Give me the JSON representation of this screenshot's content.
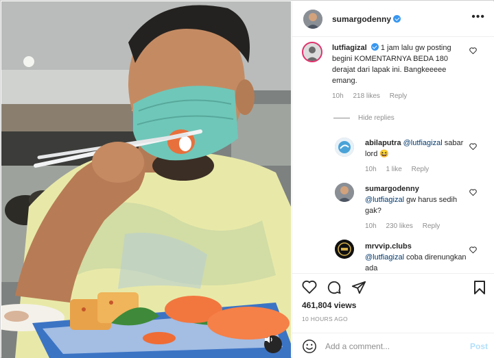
{
  "post": {
    "author": "sumargodenny",
    "more_icon": "more-horizontal-icon"
  },
  "comments": {
    "main": {
      "user": "lutfiagizal",
      "text": "1 jam lalu gw posting begini KOMENTARNYA BEDA 180 derajat dari lapak ini. Bangkeeeee emang.",
      "time": "10h",
      "likes": "218 likes",
      "reply": "Reply"
    },
    "hide_replies": "Hide replies",
    "replies": [
      {
        "user": "abilaputra",
        "mention": "@lutfiagizal",
        "text": "sabar lord 😆",
        "time": "10h",
        "likes": "1 like",
        "reply": "Reply"
      },
      {
        "user": "sumargodenny",
        "mention": "@lutfiagizal",
        "text": "gw harus sedih gak?",
        "time": "10h",
        "likes": "230 likes",
        "reply": "Reply"
      },
      {
        "user": "mrvvip.clubs",
        "mention": "@lutfiagizal",
        "text": "coba direnungkan ada",
        "time": "",
        "likes": "",
        "reply": ""
      }
    ]
  },
  "stats": {
    "views": "461,804 views",
    "time_ago": "10 HOURS AGO"
  },
  "composer": {
    "placeholder": "Add a comment...",
    "post_label": "Post"
  },
  "colors": {
    "link": "#00376b",
    "verified": "#3897f0",
    "muted": "#8e8e8e",
    "post_disabled": "#b2dffc"
  }
}
